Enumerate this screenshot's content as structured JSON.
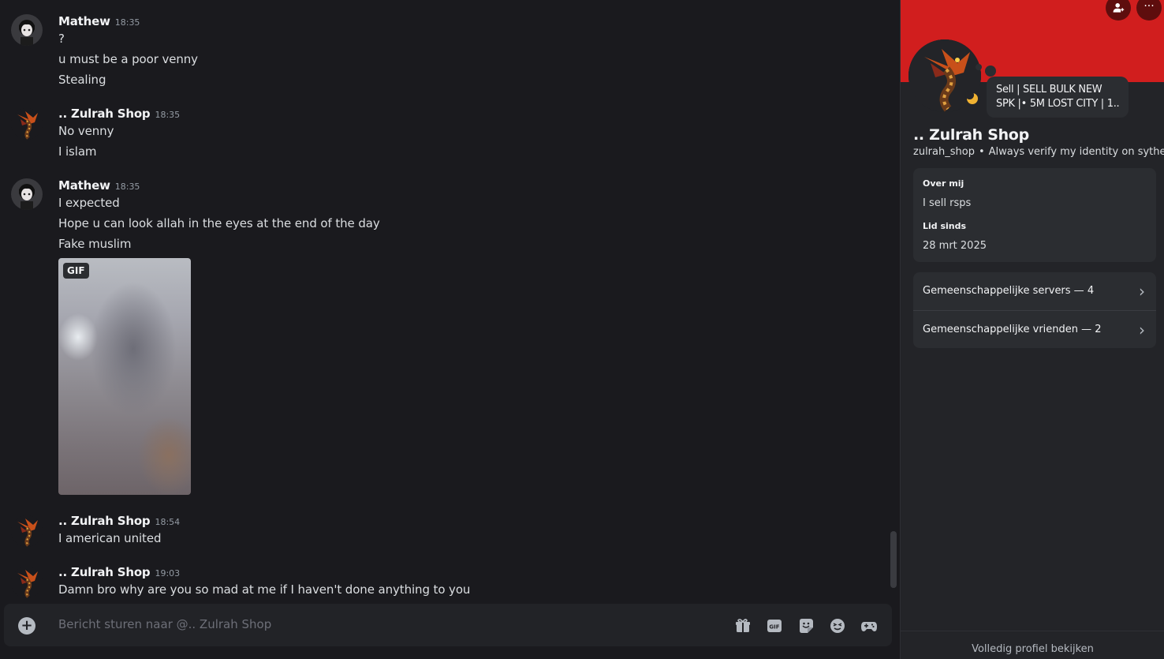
{
  "chat": {
    "groups": [
      {
        "author": "Mathew",
        "time": "18:35",
        "avatar": "anime-avatar",
        "lines": [
          "?",
          "u must be a poor venny",
          "Stealing"
        ]
      },
      {
        "author": ".. Zulrah Shop",
        "time": "18:35",
        "avatar": "zulrah-avatar",
        "lines": [
          "No venny",
          "I islam"
        ]
      },
      {
        "author": "Mathew",
        "time": "18:35",
        "avatar": "anime-avatar",
        "lines": [
          "I expected",
          "Hope u can look allah in the eyes at the end of the day",
          "Fake muslim"
        ],
        "gif_badge": "GIF"
      },
      {
        "author": ".. Zulrah Shop",
        "time": "18:54",
        "avatar": "zulrah-avatar",
        "lines": [
          "I american united"
        ]
      },
      {
        "author": ".. Zulrah Shop",
        "time": "19:03",
        "avatar": "zulrah-avatar",
        "lines": [
          "Damn bro why are you so mad at me if I haven't done anything to you"
        ]
      }
    ]
  },
  "composer": {
    "placeholder": "Bericht sturen naar @.. Zulrah Shop",
    "icons": [
      "gift-icon",
      "gif-icon",
      "sticker-icon",
      "emoji-icon",
      "activity-icon"
    ]
  },
  "profile": {
    "banner_color": "#d11e1e",
    "status_text": "Sell | SELL BULK NEW SPK |• 5M LOST CITY | 1...",
    "status_line1": "Sell | SELL BULK NEW",
    "status_line2": "SPK |• 5M LOST CITY | 1...",
    "display_name": ".. Zulrah Shop",
    "username": "zulrah_shop",
    "separator": "•",
    "pronouns": "Always verify my identity on sythe",
    "about_label": "Over mij",
    "about_value": "I sell rsps",
    "member_since_label": "Lid sinds",
    "member_since_value": "28 mrt 2025",
    "mutual_servers": "Gemeenschappelijke servers — 4",
    "mutual_friends": "Gemeenschappelijke vrienden — 2",
    "footer": "Volledig profiel bekijken"
  },
  "colors": {
    "background": "#1a1a1e",
    "panel": "#232428",
    "card": "#2b2d31",
    "status_idle": "#f0b232"
  }
}
